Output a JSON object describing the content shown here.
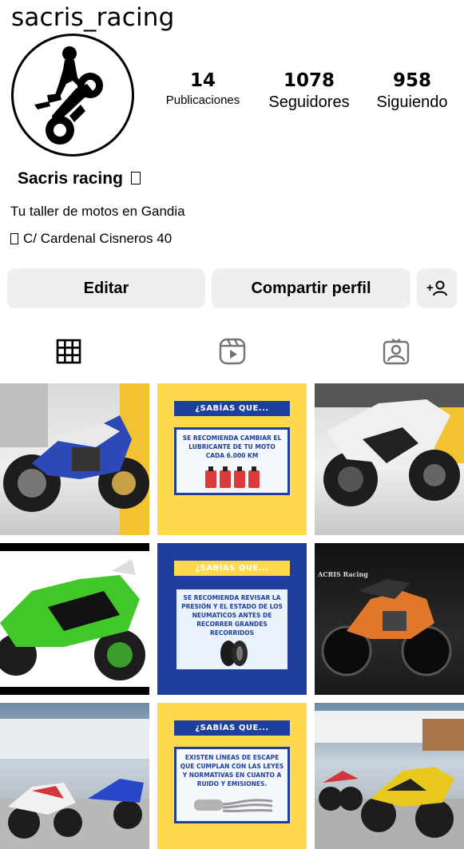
{
  "profile": {
    "username": "sacris_racing",
    "display_name": "Sacris racing",
    "bio": "Tu taller de motos en Gandia",
    "address": "C/ Cardenal Cisneros 40"
  },
  "stats": {
    "posts_count": "14",
    "posts_label": "Publicaciones",
    "followers_count": "1078",
    "followers_label": "Seguidores",
    "following_count": "958",
    "following_label": "Siguiendo"
  },
  "actions": {
    "edit_label": "Editar",
    "share_label": "Compartir perfil",
    "add_person_label": "+"
  },
  "tabs": [
    {
      "icon": "grid-icon",
      "active": true
    },
    {
      "icon": "reels-icon",
      "active": false
    },
    {
      "icon": "tagged-icon",
      "active": false
    }
  ],
  "posts": {
    "info1": {
      "heading": "¿SABÍAS QUE...",
      "text": "SE RECOMIENDA CAMBIAR EL LUBRICANTE DE TU MOTO CADA 6.000 KM"
    },
    "info2": {
      "heading": "¿SABÍAS QUE...",
      "text": "SE RECOMIENDA REVISAR LA PRESIÓN Y EL ESTADO DE LOS NEUMATICOS ANTES DE RECORRER GRANDES RECORRIDOS"
    },
    "info3": {
      "heading": "¿SABÍAS QUE...",
      "text": "EXISTEN LÍNEAS DE ESCAPE QUE CUMPLAN CON LAS LEYES Y NORMATIVAS EN CUANTO A RUIDO Y EMISIONES."
    },
    "watermark": "ACRIS Racing"
  },
  "colors": {
    "button_bg": "#efefef",
    "info_yellow": "#fdd94b",
    "info_blue": "#1e3f9e"
  }
}
